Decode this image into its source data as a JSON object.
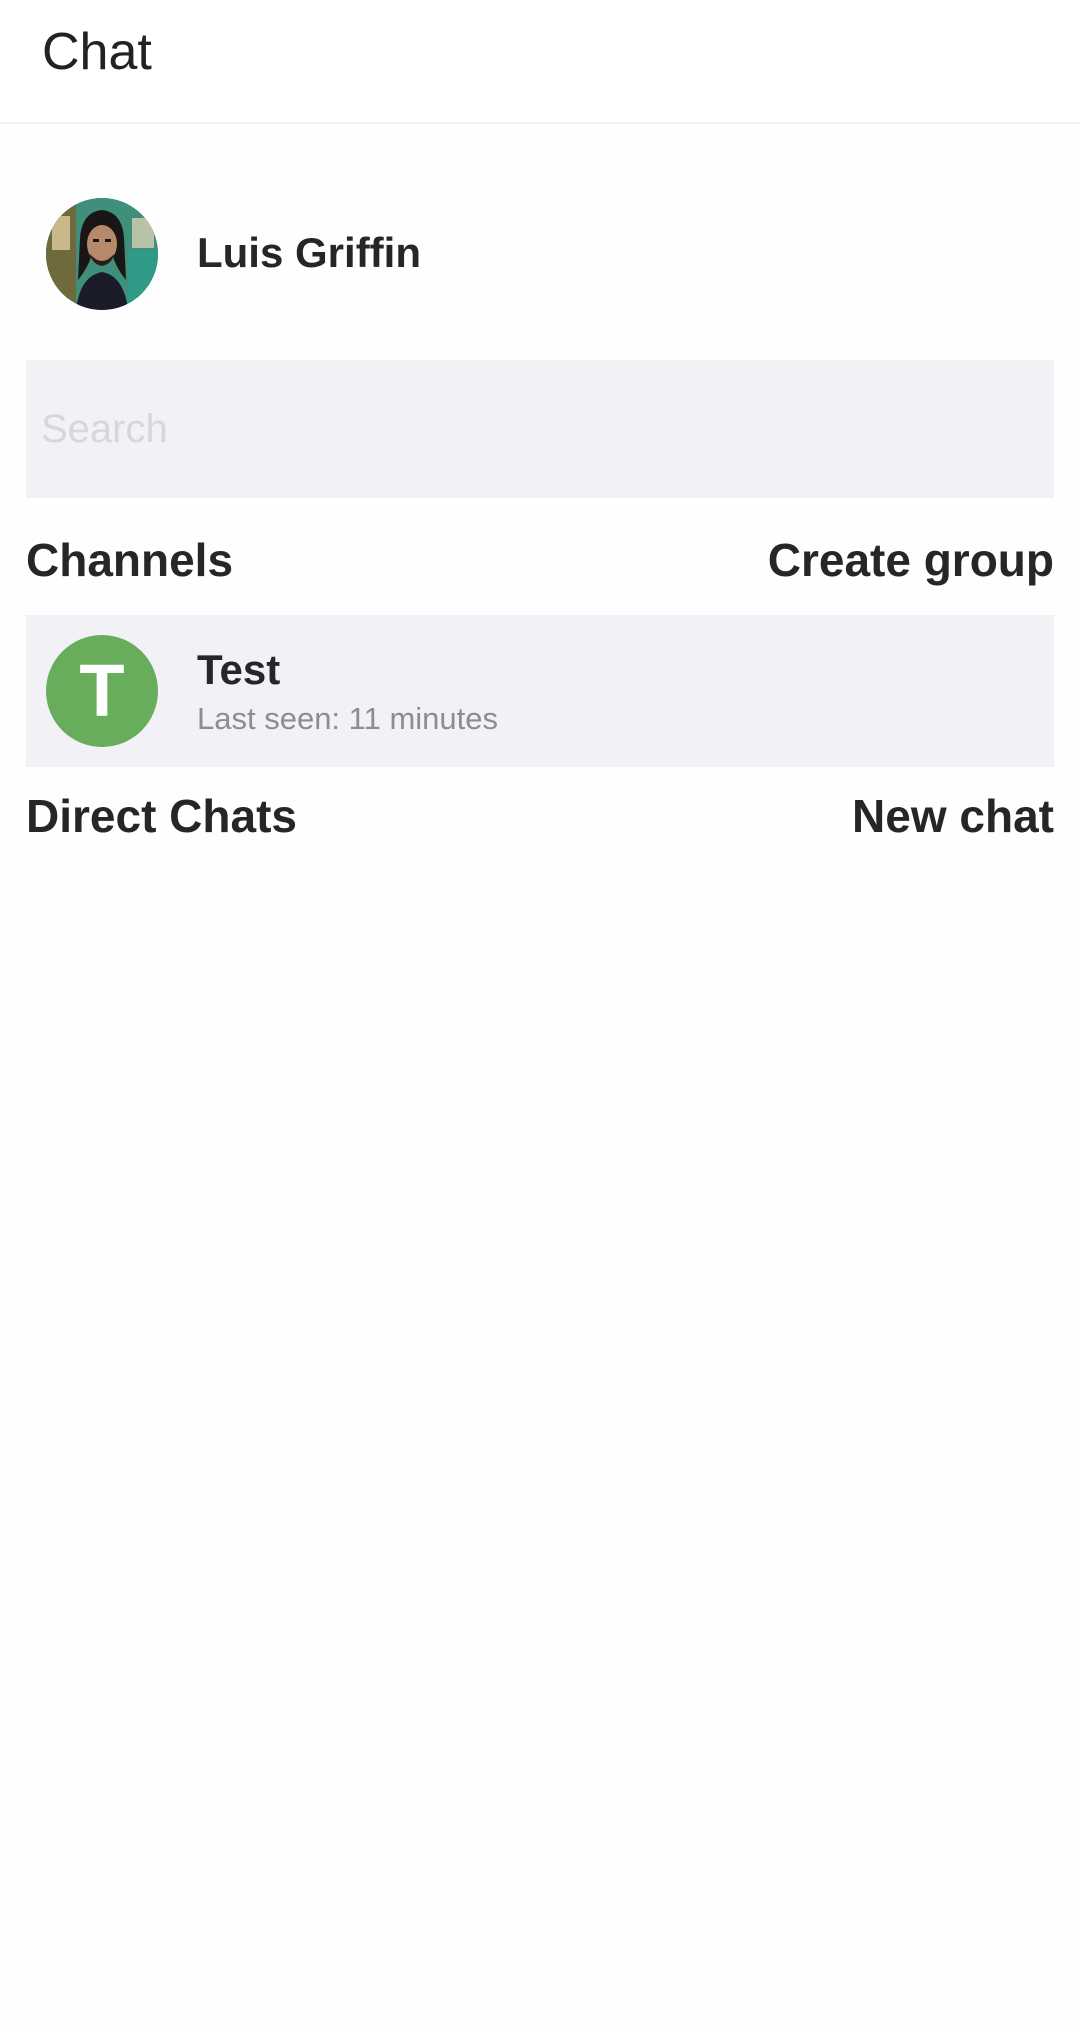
{
  "app_bar": {
    "title": "Chat"
  },
  "profile": {
    "name": "Luis Griffin",
    "avatar": "user-photo-avatar"
  },
  "search": {
    "placeholder": "Search",
    "value": ""
  },
  "channels": {
    "title": "Channels",
    "action_label": "Create group",
    "items": [
      {
        "initial": "T",
        "name": "Test",
        "status": "Last seen: 11 minutes",
        "avatar_color": "#67ad5b"
      }
    ]
  },
  "direct_chats": {
    "title": "Direct Chats",
    "action_label": "New chat",
    "items": []
  },
  "colors": {
    "background": "#fefefe",
    "surface": "#f1f1f6",
    "text_primary": "#262628",
    "text_secondary": "#8c8c92",
    "placeholder": "#d6d6dd",
    "channel_avatar": "#67ad5b"
  }
}
